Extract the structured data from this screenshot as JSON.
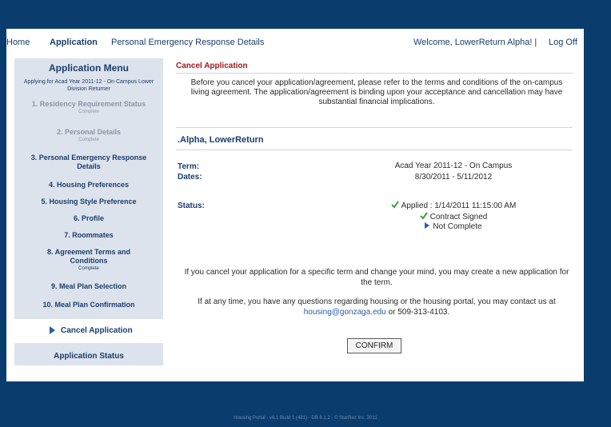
{
  "topnav": {
    "home": "Home",
    "application": "Application",
    "personal_emergency": "Personal Emergency Response Details",
    "welcome": "Welcome, LowerReturn  Alpha! |",
    "logoff": "Log Off"
  },
  "sidebar": {
    "title": "Application Menu",
    "subtitle": "Applying for Acad Year 2011-12 - On Campus Lower Division Returner",
    "items": [
      {
        "label": "1. Residency Requirement Status",
        "sub": "Complete"
      },
      {
        "label": "2. Personal Details",
        "sub": "Complete"
      },
      {
        "label": "3. Personal Emergency Response Details",
        "sub": ""
      },
      {
        "label": "4. Housing Preferences",
        "sub": ""
      },
      {
        "label": "5. Housing Style Preference",
        "sub": ""
      },
      {
        "label": "6. Profile",
        "sub": ""
      },
      {
        "label": "7. Roommates",
        "sub": ""
      },
      {
        "label": "8. Agreement Terms and Conditions",
        "sub": "Complete"
      },
      {
        "label": "9. Meal Plan Selection",
        "sub": ""
      },
      {
        "label": "10. Meal Plan Confirmation",
        "sub": ""
      }
    ],
    "cancel": "Cancel Application",
    "status": "Application Status"
  },
  "main": {
    "header": "Cancel Application",
    "warning": "Before you cancel your application/agreement, please refer to the terms and conditions of the on-campus living agreement. The application/agreement is binding upon your acceptance and cancellation may have substantial financial implications.",
    "name": ".Alpha, LowerReturn",
    "term_label": "Term:",
    "term_value": "Acad Year 2011-12 - On Campus",
    "dates_label": "Dates:",
    "dates_value": "8/30/2011 - 5/11/2012",
    "status_label": "Status:",
    "status_lines": [
      "Applied : 1/14/2011 11:15:00 AM",
      "Contract Signed",
      "Not Complete"
    ],
    "note1": "If you cancel your application for a specific term and change your mind, you may create a new application for the term.",
    "note2_pre": "If at any time, you have any questions regarding housing or the housing portal, you may contact us at",
    "note2_email": "housing@gonzaga.edu",
    "note2_post": "or 509-313-4103.",
    "confirm": "CONFIRM"
  },
  "footer": "Housing Portal - v6.1 Build 1 (481) - DB 8.1.2 - © StarRez Inc. 2011",
  "colors": {
    "accent": "#1a3d6e",
    "header_red": "#a21a1a",
    "check_green": "#3aa43a",
    "link_blue": "#2a5ca8"
  }
}
